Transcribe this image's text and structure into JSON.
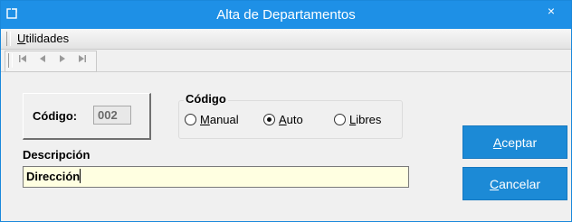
{
  "window": {
    "title": "Alta de Departamentos",
    "close_glyph": "×",
    "accent": "#1e90e6"
  },
  "menu": {
    "items": [
      {
        "accel": "U",
        "rest": "tilidades"
      }
    ]
  },
  "toolbar": {
    "nav": [
      "first-icon",
      "prev-icon",
      "next-icon",
      "last-icon"
    ]
  },
  "form": {
    "code_label": "Código:",
    "code_value": "002",
    "code_group_title": "Código",
    "radios": [
      {
        "accel": "M",
        "rest": "anual",
        "checked": false
      },
      {
        "accel": "A",
        "rest": "uto",
        "checked": true
      },
      {
        "accel": "L",
        "rest": "ibres",
        "checked": false
      }
    ],
    "description_label": "Descripción",
    "description_value": "Dirección"
  },
  "buttons": {
    "accept": {
      "accel": "A",
      "rest": "ceptar"
    },
    "cancel": {
      "accel": "C",
      "rest": "ancelar"
    }
  }
}
